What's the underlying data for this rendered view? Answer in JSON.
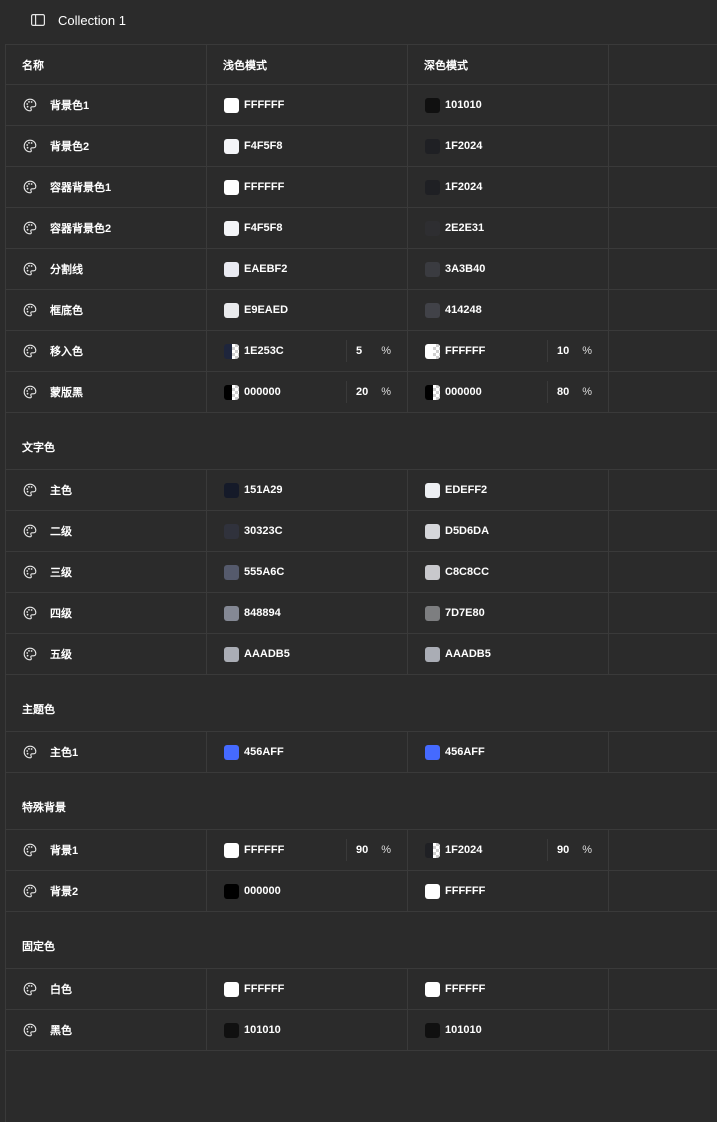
{
  "header": {
    "title": "Collection 1"
  },
  "columns": {
    "name": "名称",
    "light": "浅色模式",
    "dark": "深色模式"
  },
  "groups": [
    {
      "section": "",
      "rows": [
        {
          "name": "背景色1",
          "light": {
            "hex": "FFFFFF",
            "color": "#FFFFFF"
          },
          "dark": {
            "hex": "101010",
            "color": "#101010"
          }
        },
        {
          "name": "背景色2",
          "light": {
            "hex": "F4F5F8",
            "color": "#F4F5F8"
          },
          "dark": {
            "hex": "1F2024",
            "color": "#1F2024"
          }
        },
        {
          "name": "容器背景色1",
          "light": {
            "hex": "FFFFFF",
            "color": "#FFFFFF"
          },
          "dark": {
            "hex": "1F2024",
            "color": "#1F2024"
          }
        },
        {
          "name": "容器背景色2",
          "light": {
            "hex": "F4F5F8",
            "color": "#F4F5F8"
          },
          "dark": {
            "hex": "2E2E31",
            "color": "#2E2E31"
          }
        },
        {
          "name": "分割线",
          "light": {
            "hex": "EAEBF2",
            "color": "#EAEBF2"
          },
          "dark": {
            "hex": "3A3B40",
            "color": "#3A3B40"
          }
        },
        {
          "name": "框底色",
          "light": {
            "hex": "E9EAED",
            "color": "#E9EAED"
          },
          "dark": {
            "hex": "414248",
            "color": "#414248"
          }
        },
        {
          "name": "移入色",
          "light": {
            "hex": "1E253C",
            "color": "#1E253C",
            "pct": "5",
            "sign": "%",
            "alpha": true
          },
          "dark": {
            "hex": "FFFFFF",
            "color": "#FFFFFF",
            "pct": "10",
            "sign": "%",
            "alpha": true
          }
        },
        {
          "name": "蒙版黑",
          "light": {
            "hex": "000000",
            "color": "#000000",
            "pct": "20",
            "sign": "%",
            "alpha": true
          },
          "dark": {
            "hex": "000000",
            "color": "#000000",
            "pct": "80",
            "sign": "%",
            "alpha": true
          }
        }
      ]
    },
    {
      "section": "文字色",
      "rows": [
        {
          "name": "主色",
          "light": {
            "hex": "151A29",
            "color": "#151A29"
          },
          "dark": {
            "hex": "EDEFF2",
            "color": "#EDEFF2"
          }
        },
        {
          "name": "二级",
          "light": {
            "hex": "30323C",
            "color": "#30323C"
          },
          "dark": {
            "hex": "D5D6DA",
            "color": "#D5D6DA"
          }
        },
        {
          "name": "三级",
          "light": {
            "hex": "555A6C",
            "color": "#555A6C"
          },
          "dark": {
            "hex": "C8C8CC",
            "color": "#C8C8CC"
          }
        },
        {
          "name": "四级",
          "light": {
            "hex": "848894",
            "color": "#848894"
          },
          "dark": {
            "hex": "7D7E80",
            "color": "#7D7E80"
          }
        },
        {
          "name": "五级",
          "light": {
            "hex": "AAADB5",
            "color": "#AAADB5"
          },
          "dark": {
            "hex": "AAADB5",
            "color": "#AAADB5"
          }
        }
      ]
    },
    {
      "section": "主题色",
      "rows": [
        {
          "name": "主色1",
          "light": {
            "hex": "456AFF",
            "color": "#456AFF"
          },
          "dark": {
            "hex": "456AFF",
            "color": "#456AFF"
          }
        }
      ]
    },
    {
      "section": "特殊背景",
      "rows": [
        {
          "name": "背景1",
          "light": {
            "hex": "FFFFFF",
            "color": "#FFFFFF",
            "pct": "90",
            "sign": "%",
            "alpha": false
          },
          "dark": {
            "hex": "1F2024",
            "color": "#1F2024",
            "pct": "90",
            "sign": "%",
            "alpha": true
          }
        },
        {
          "name": "背景2",
          "light": {
            "hex": "000000",
            "color": "#000000"
          },
          "dark": {
            "hex": "FFFFFF",
            "color": "#FFFFFF"
          }
        }
      ]
    },
    {
      "section": "固定色",
      "rows": [
        {
          "name": "白色",
          "light": {
            "hex": "FFFFFF",
            "color": "#FFFFFF"
          },
          "dark": {
            "hex": "FFFFFF",
            "color": "#FFFFFF"
          }
        },
        {
          "name": "黑色",
          "light": {
            "hex": "101010",
            "color": "#101010"
          },
          "dark": {
            "hex": "101010",
            "color": "#101010"
          }
        }
      ]
    }
  ]
}
